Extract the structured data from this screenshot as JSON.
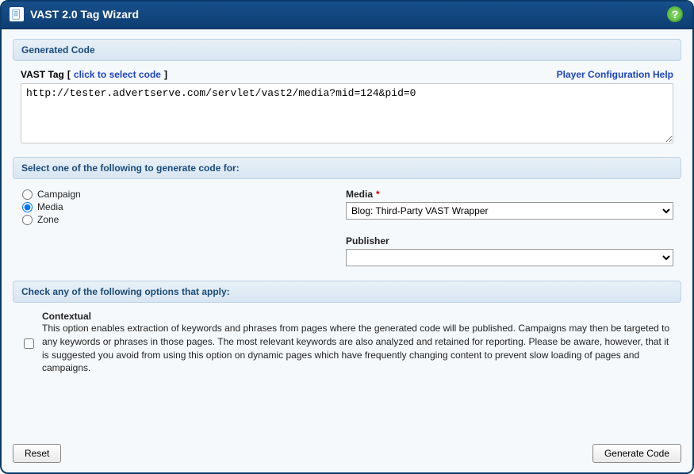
{
  "window": {
    "title": "VAST 2.0 Tag Wizard"
  },
  "generated": {
    "heading": "Generated Code",
    "tag_prefix": "VAST Tag",
    "bracket_open": "[",
    "click_select": "click to select code",
    "bracket_close": "]",
    "player_help": "Player Configuration Help",
    "code_value": "http://tester.advertserve.com/servlet/vast2/media?mid=124&pid=0"
  },
  "select_for": {
    "heading": "Select one of the following to generate code for:",
    "radios": {
      "campaign": "Campaign",
      "media": "Media",
      "zone": "Zone"
    },
    "media_label": "Media",
    "media_required_marker": "*",
    "media_options": [
      "Blog: Third-Party VAST Wrapper"
    ],
    "media_selected": "Blog: Third-Party VAST Wrapper",
    "publisher_label": "Publisher",
    "publisher_options": [
      ""
    ],
    "publisher_selected": ""
  },
  "options": {
    "heading": "Check any of the following options that apply:",
    "contextual_title": "Contextual",
    "contextual_desc": "This option enables extraction of keywords and phrases from pages where the generated code will be published. Campaigns may then be targeted to any keywords or phrases in those pages. The most relevant keywords are also analyzed and retained for reporting. Please be aware, however, that it is suggested you avoid from using this option on dynamic pages which have frequently changing content to prevent slow loading of pages and campaigns."
  },
  "buttons": {
    "reset": "Reset",
    "generate": "Generate Code"
  },
  "icons": {
    "help": "?"
  }
}
